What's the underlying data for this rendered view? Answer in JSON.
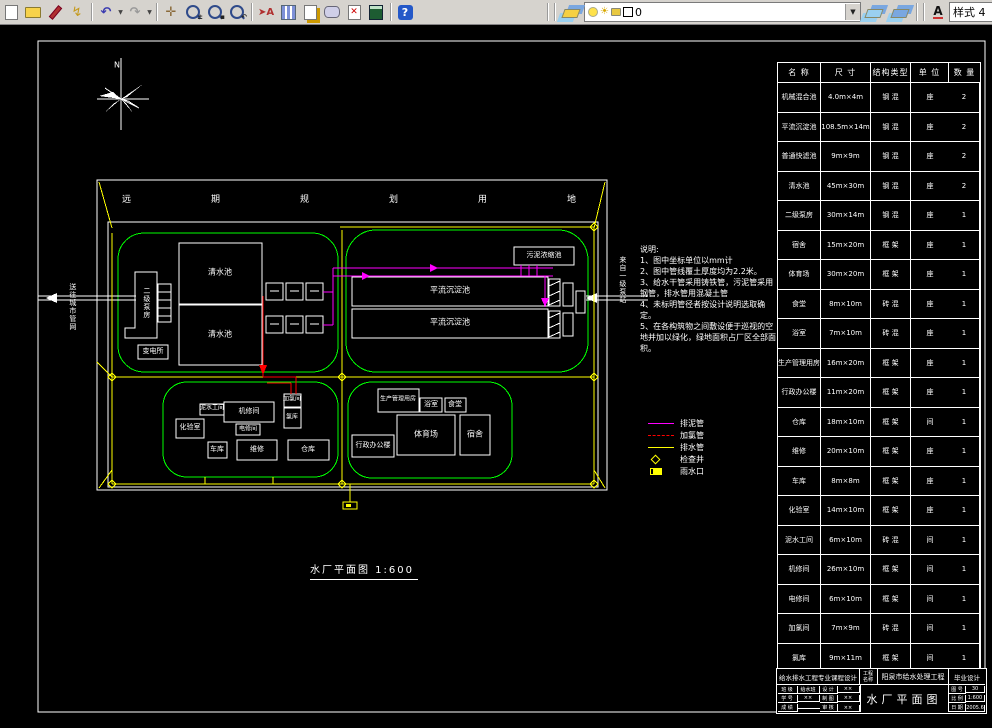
{
  "toolbar": {
    "layer_combo": {
      "value": "0"
    },
    "style_combo": {
      "value": "样式 4"
    },
    "help_label": "?"
  },
  "drawing": {
    "north": "N",
    "band": "远期规划用地",
    "scale_title": "水厂平面图  1:600",
    "inlet": "来自一级泵站",
    "outlet": "送往城市管网",
    "labels": {
      "clear1": "清水池",
      "clear2": "清水池",
      "pump": "二级泵房",
      "substation": "变电所",
      "sed1": "平流沉淀池",
      "sed2": "平流沉淀池",
      "thickener": "污泥浓缩池",
      "mudroom": "泥水工间",
      "mech": "机修间",
      "lab": "化验室",
      "elec": "电修间",
      "garage": "车库",
      "repair": "维修",
      "store": "仓库",
      "chlorine_room": "加氯间",
      "chlorine_store": "氯库",
      "mgmt": "生产管理用房",
      "bath": "浴室",
      "canteen": "食堂",
      "sports": "体育场",
      "admin": "行政办公楼",
      "dorm": "宿舍"
    },
    "notes": {
      "title": "说明:",
      "items": [
        "1、图中坐标单位以mm计",
        "2、图中管线覆土厚度均为2.2米。",
        "3、给水干管采用铸铁管，污泥管采用钢管，排水管用混凝土管",
        "4、未标明管径者按设计说明选取确定。",
        "5、在各构筑物之间敷设便于巡视的空地并加以绿化，绿地面积占厂区全部面积。"
      ]
    },
    "legend": {
      "items": [
        {
          "label": "排泥管"
        },
        {
          "label": "加氯管"
        },
        {
          "label": "排水管"
        },
        {
          "label": "检查井"
        },
        {
          "label": "雨水口"
        }
      ]
    },
    "colors": {
      "sludge": "#ff00ff",
      "chlorine": "#ff0000",
      "drain": "#ffff00",
      "zone": "#00ff00",
      "line": "#ffffff"
    }
  },
  "table": {
    "headers": [
      "名 称",
      "尺 寸",
      "结构类型",
      "单 位",
      "数 量"
    ],
    "rows": [
      [
        "机械混合池",
        "4.0m×4m",
        "钢 混",
        "座",
        "2"
      ],
      [
        "平流沉淀池",
        "108.5m×14m",
        "钢 混",
        "座",
        "2"
      ],
      [
        "普通快滤池",
        "9m×9m",
        "钢 混",
        "座",
        "2"
      ],
      [
        "清水池",
        "45m×30m",
        "钢 混",
        "座",
        "2"
      ],
      [
        "二级泵房",
        "30m×14m",
        "钢 混",
        "座",
        "1"
      ],
      [
        "宿舍",
        "15m×20m",
        "框 架",
        "座",
        "1"
      ],
      [
        "体育场",
        "30m×20m",
        "框 架",
        "座",
        "1"
      ],
      [
        "食堂",
        "8m×10m",
        "砖 混",
        "座",
        "1"
      ],
      [
        "浴室",
        "7m×10m",
        "砖 混",
        "座",
        "1"
      ],
      [
        "生产管理用房",
        "16m×20m",
        "框 架",
        "座",
        "1"
      ],
      [
        "行政办公楼",
        "11m×20m",
        "框 架",
        "座",
        "1"
      ],
      [
        "仓库",
        "18m×10m",
        "框 架",
        "间",
        "1"
      ],
      [
        "维修",
        "20m×10m",
        "框 架",
        "座",
        "1"
      ],
      [
        "车库",
        "8m×8m",
        "框 架",
        "座",
        "1"
      ],
      [
        "化验室",
        "14m×10m",
        "框 架",
        "座",
        "1"
      ],
      [
        "泥水工间",
        "6m×10m",
        "砖 混",
        "间",
        "1"
      ],
      [
        "机修间",
        "26m×10m",
        "框 架",
        "间",
        "1"
      ],
      [
        "电修间",
        "6m×10m",
        "框 架",
        "间",
        "1"
      ],
      [
        "加氯间",
        "7m×9m",
        "砖 混",
        "间",
        "1"
      ],
      [
        "氯库",
        "9m×11m",
        "框 架",
        "间",
        "1"
      ]
    ]
  },
  "titleblock": {
    "school": "给水排水工程专业课程设计",
    "project_label": "工程名称",
    "project_name": "阳泉市给水处理工程",
    "doc_type": "毕业设计",
    "sheet_title": "水厂平面图",
    "info": [
      [
        "图 号",
        "30"
      ],
      [
        "比 例",
        "1:600"
      ],
      [
        "日 期",
        "2005.6"
      ]
    ],
    "mini": [
      [
        "班 级",
        "给水班",
        "设 计",
        "××"
      ],
      [
        "学 号",
        "××",
        "制 图",
        "××"
      ],
      [
        "成 绩",
        "",
        "审 核",
        "××"
      ]
    ]
  }
}
